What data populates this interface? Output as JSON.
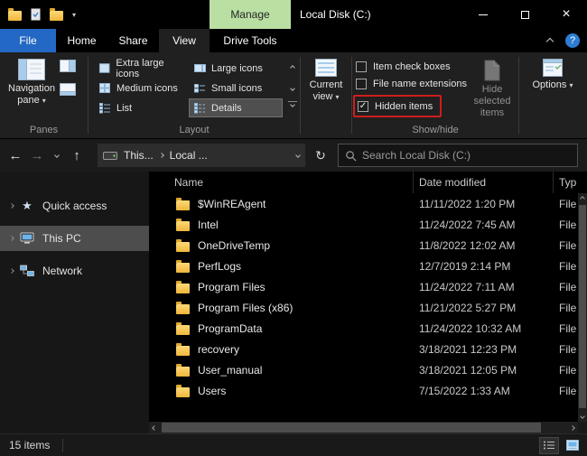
{
  "colors": {
    "accent_blue": "#2368c4",
    "manage_green": "#b9dfa2",
    "highlight_red": "#cf1d1d",
    "folder_yellow": "#f5c94c",
    "selection_gray": "#4d4d4d"
  },
  "icons": {
    "dropdown": "▾",
    "check": "✓",
    "back": "←",
    "forward": "→",
    "up": "↑",
    "refresh": "↻",
    "star": "★",
    "close": "×",
    "help": "?"
  },
  "titlebar": {
    "manage_label": "Manage",
    "title": "Local Disk (C:)"
  },
  "tabs": {
    "file": "File",
    "home": "Home",
    "share": "Share",
    "view": "View",
    "drive_tools": "Drive Tools"
  },
  "ribbon": {
    "panes": {
      "navigation_pane": "Navigation pane",
      "group_label": "Panes"
    },
    "layout": {
      "items": [
        {
          "label": "Extra large icons",
          "selected": false
        },
        {
          "label": "Large icons",
          "selected": false
        },
        {
          "label": "Medium icons",
          "selected": false
        },
        {
          "label": "Small icons",
          "selected": false
        },
        {
          "label": "List",
          "selected": false
        },
        {
          "label": "Details",
          "selected": true
        }
      ],
      "group_label": "Layout"
    },
    "current_view": {
      "label": "Current view"
    },
    "show_hide": {
      "checkboxes": [
        {
          "label": "Item check boxes",
          "checked": false,
          "highlighted": false
        },
        {
          "label": "File name extensions",
          "checked": false,
          "highlighted": false
        },
        {
          "label": "Hidden items",
          "checked": true,
          "highlighted": true
        }
      ],
      "hide_selected": "Hide selected items",
      "group_label": "Show/hide"
    },
    "options": {
      "label": "Options"
    }
  },
  "addressbar": {
    "breadcrumb": {
      "root": "This...",
      "current": "Local ..."
    },
    "search_placeholder": "Search Local Disk (C:)"
  },
  "sidebar": {
    "items": [
      {
        "label": "Quick access",
        "selected": false
      },
      {
        "label": "This PC",
        "selected": true
      },
      {
        "label": "Network",
        "selected": false
      }
    ]
  },
  "filelist": {
    "columns": {
      "name": "Name",
      "date": "Date modified",
      "type": "Typ"
    },
    "rows": [
      {
        "name": "$WinREAgent",
        "date": "11/11/2022 1:20 PM",
        "type": "File"
      },
      {
        "name": "Intel",
        "date": "11/24/2022 7:45 AM",
        "type": "File"
      },
      {
        "name": "OneDriveTemp",
        "date": "11/8/2022 12:02 AM",
        "type": "File"
      },
      {
        "name": "PerfLogs",
        "date": "12/7/2019 2:14 PM",
        "type": "File"
      },
      {
        "name": "Program Files",
        "date": "11/24/2022 7:11 AM",
        "type": "File"
      },
      {
        "name": "Program Files (x86)",
        "date": "11/21/2022 5:27 PM",
        "type": "File"
      },
      {
        "name": "ProgramData",
        "date": "11/24/2022 10:32 AM",
        "type": "File"
      },
      {
        "name": "recovery",
        "date": "3/18/2021 12:23 PM",
        "type": "File"
      },
      {
        "name": "User_manual",
        "date": "3/18/2021 12:05 PM",
        "type": "File"
      },
      {
        "name": "Users",
        "date": "7/15/2022 1:33 AM",
        "type": "File"
      }
    ]
  },
  "statusbar": {
    "items_count": "15 items"
  }
}
